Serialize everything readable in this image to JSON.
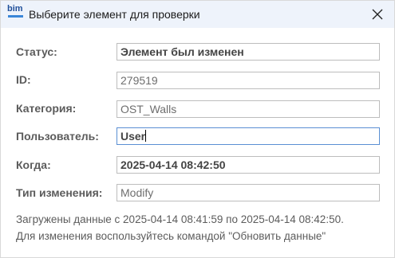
{
  "window": {
    "icon_text": "bim",
    "title": "Выберите элемент для проверки"
  },
  "icons": {
    "app": "bim-logo-icon",
    "close": "close-icon"
  },
  "form": {
    "status": {
      "label": "Статус:",
      "value": "Элемент был изменен"
    },
    "id": {
      "label": "ID:",
      "value": "279519"
    },
    "category": {
      "label": "Категория:",
      "value": "OST_Walls"
    },
    "user": {
      "label": "Пользователь:",
      "value": "User"
    },
    "when": {
      "label": "Когда:",
      "value": "2025-04-14 08:42:50"
    },
    "change_type": {
      "label": "Тип изменения:",
      "value": "Modify"
    }
  },
  "info": {
    "line1": "Загружены данные с 2025-04-14 08:41:59 по 2025-04-14 08:42:50.",
    "line2": "Для изменения воспользуйтесь командой \"Обновить данные\""
  },
  "colors": {
    "titlebar_bg": "#eef3fb",
    "active_border": "#5a8fd3",
    "logo_blue": "#1f4f9a"
  }
}
